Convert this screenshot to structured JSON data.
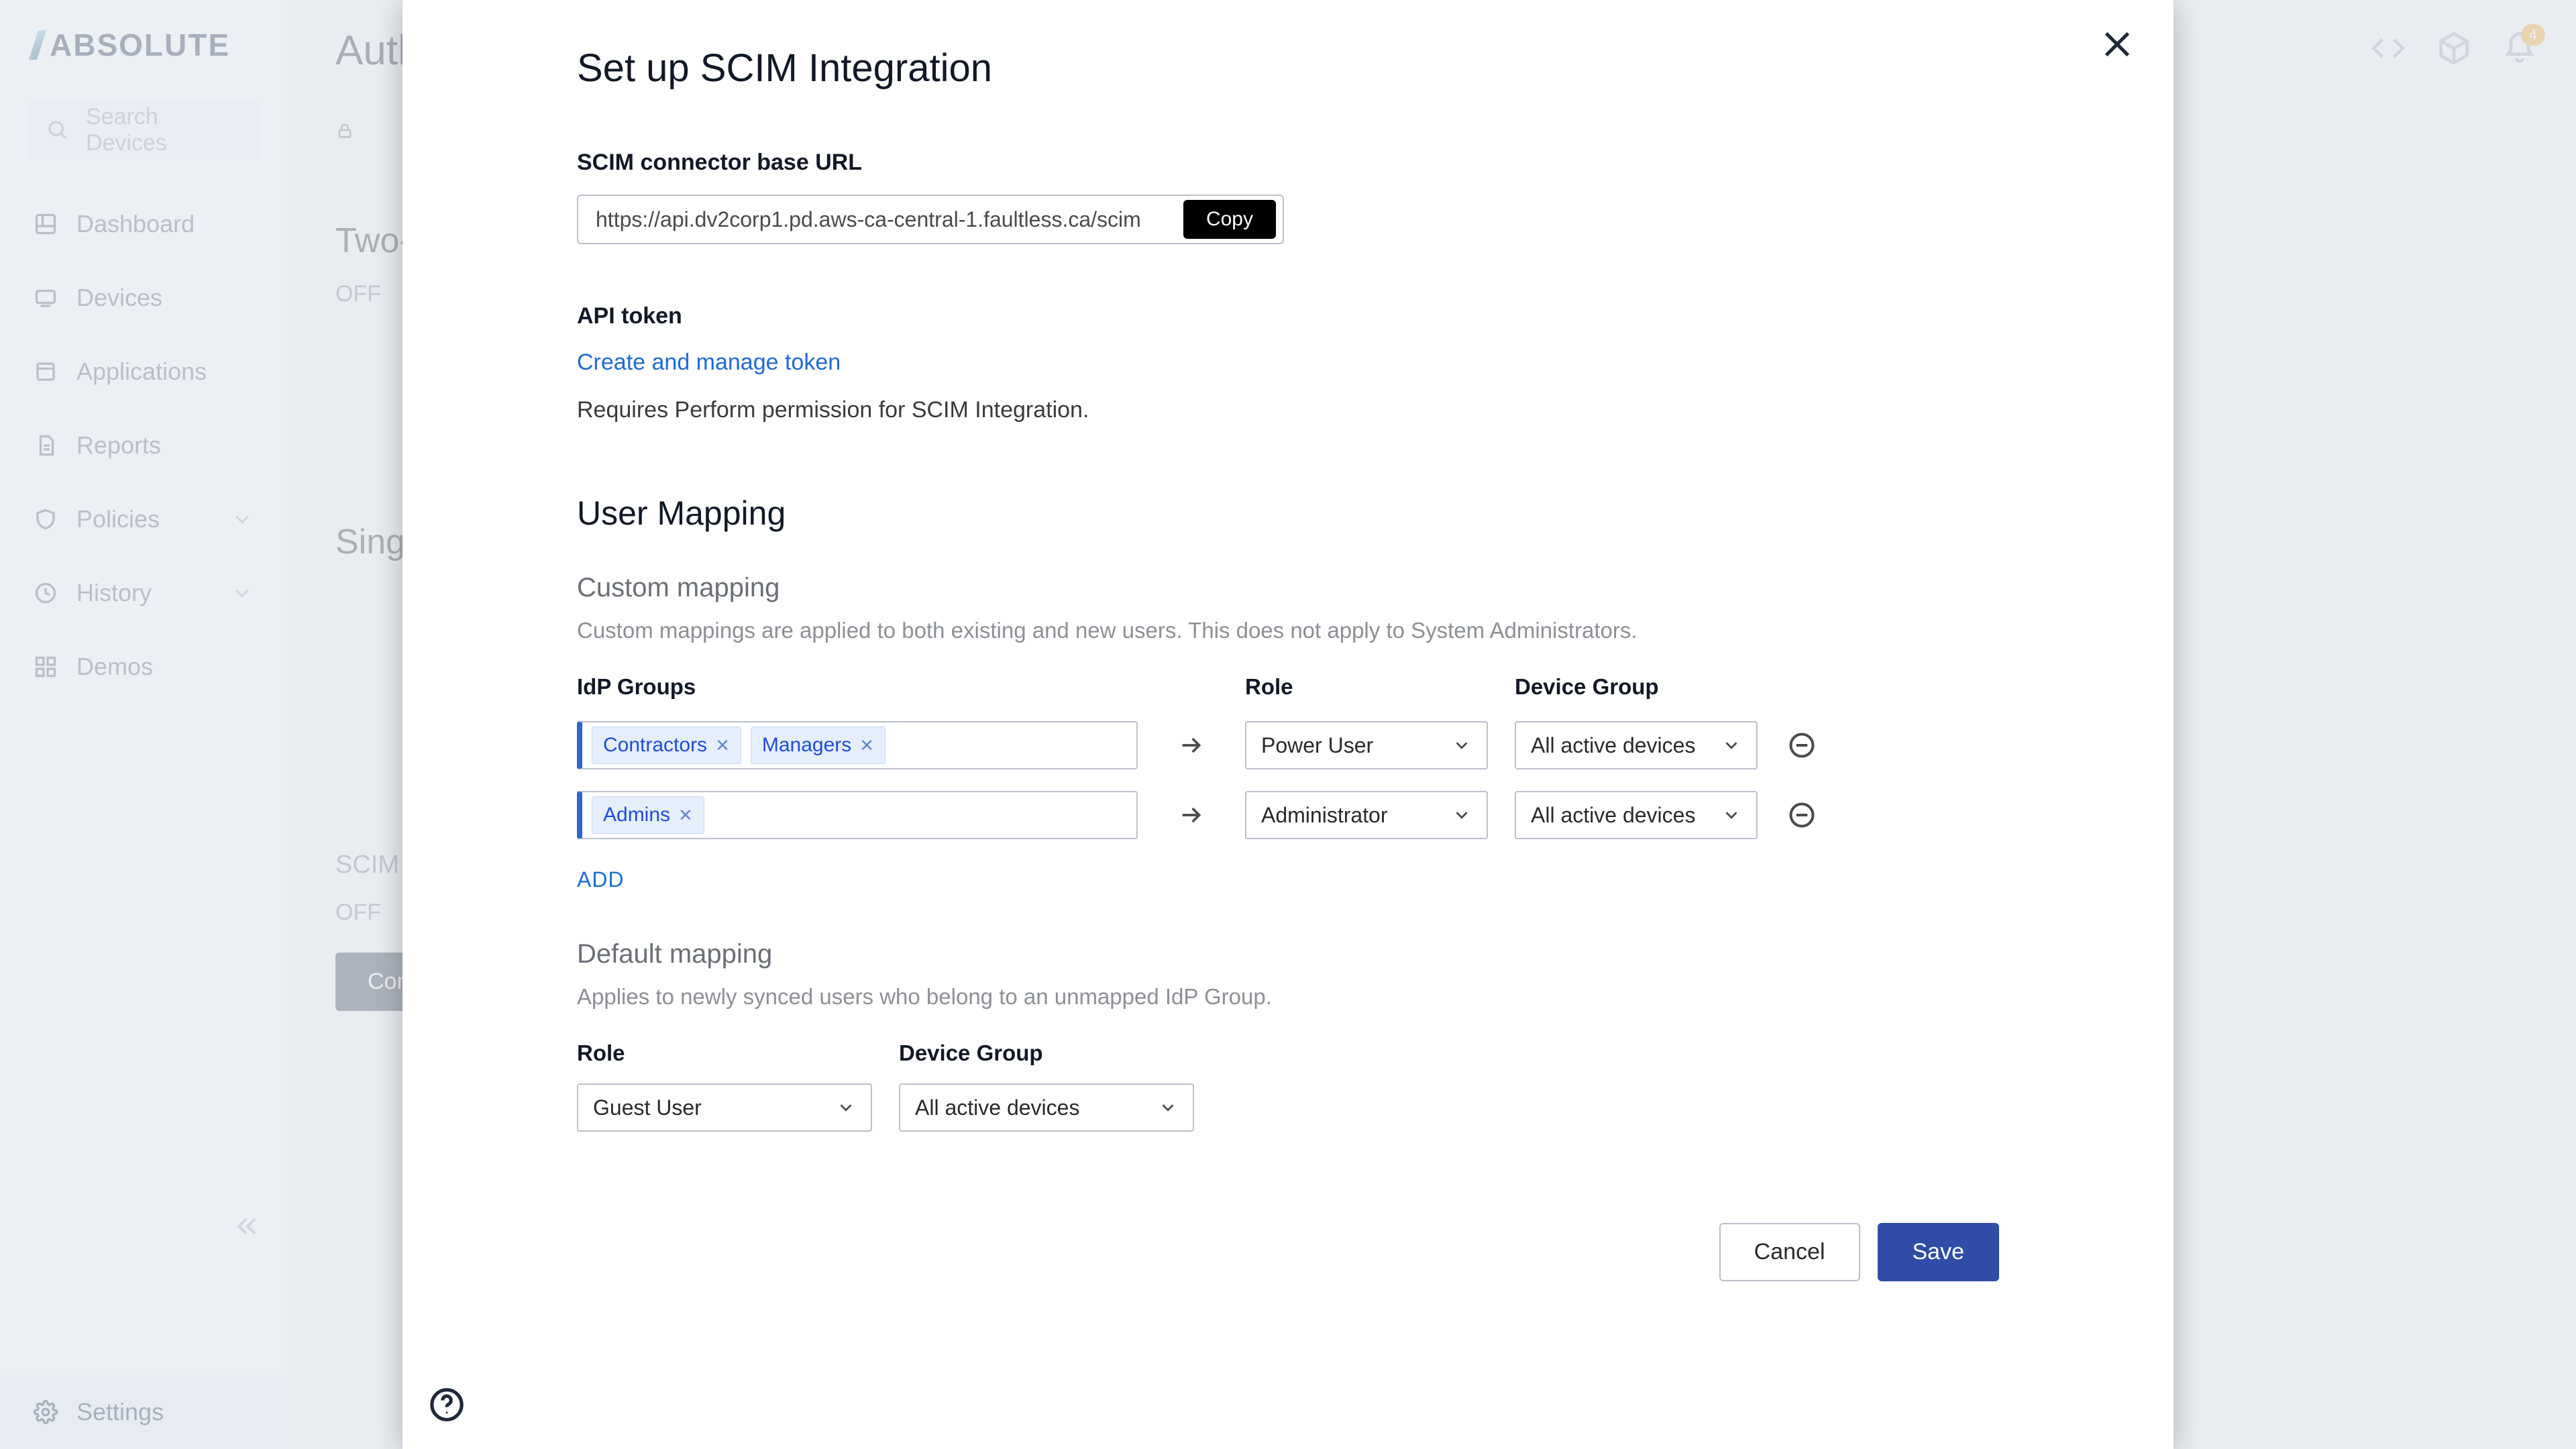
{
  "brand": "ABSOLUTE",
  "search_placeholder": "Search Devices",
  "sidebar": {
    "items": [
      {
        "label": "Dashboard"
      },
      {
        "label": "Devices"
      },
      {
        "label": "Applications"
      },
      {
        "label": "Reports"
      },
      {
        "label": "Policies"
      },
      {
        "label": "History"
      },
      {
        "label": "Demos"
      }
    ],
    "settings_label": "Settings"
  },
  "page": {
    "title": "Authentication",
    "two_factor_heading": "Two-Factor",
    "off_label": "OFF",
    "sso_heading": "Single",
    "scim_label": "SCIM",
    "button_label": "Configure"
  },
  "notifications_count": "4",
  "modal": {
    "title": "Set up SCIM Integration",
    "url_label": "SCIM connector base URL",
    "url_value": "https://api.dv2corp1.pd.aws-ca-central-1.faultless.ca/scim",
    "copy_label": "Copy",
    "token_label": "API token",
    "token_link": "Create and manage token",
    "token_desc": "Requires Perform permission for SCIM Integration.",
    "mapping_heading": "User Mapping",
    "custom_heading": "Custom mapping",
    "custom_desc": "Custom mappings are applied to both existing and new users. This does not apply to System Administrators.",
    "col_idp": "IdP Groups",
    "col_role": "Role",
    "col_device": "Device Group",
    "rows": [
      {
        "tags": [
          "Contractors",
          "Managers"
        ],
        "role": "Power User",
        "device": "All active devices"
      },
      {
        "tags": [
          "Admins"
        ],
        "role": "Administrator",
        "device": "All active devices"
      }
    ],
    "add_label": "ADD",
    "default_heading": "Default mapping",
    "default_desc": "Applies to newly synced users who belong to an unmapped IdP Group.",
    "default_role_label": "Role",
    "default_device_label": "Device Group",
    "default_role": "Guest User",
    "default_device": "All active devices",
    "cancel_label": "Cancel",
    "save_label": "Save"
  }
}
